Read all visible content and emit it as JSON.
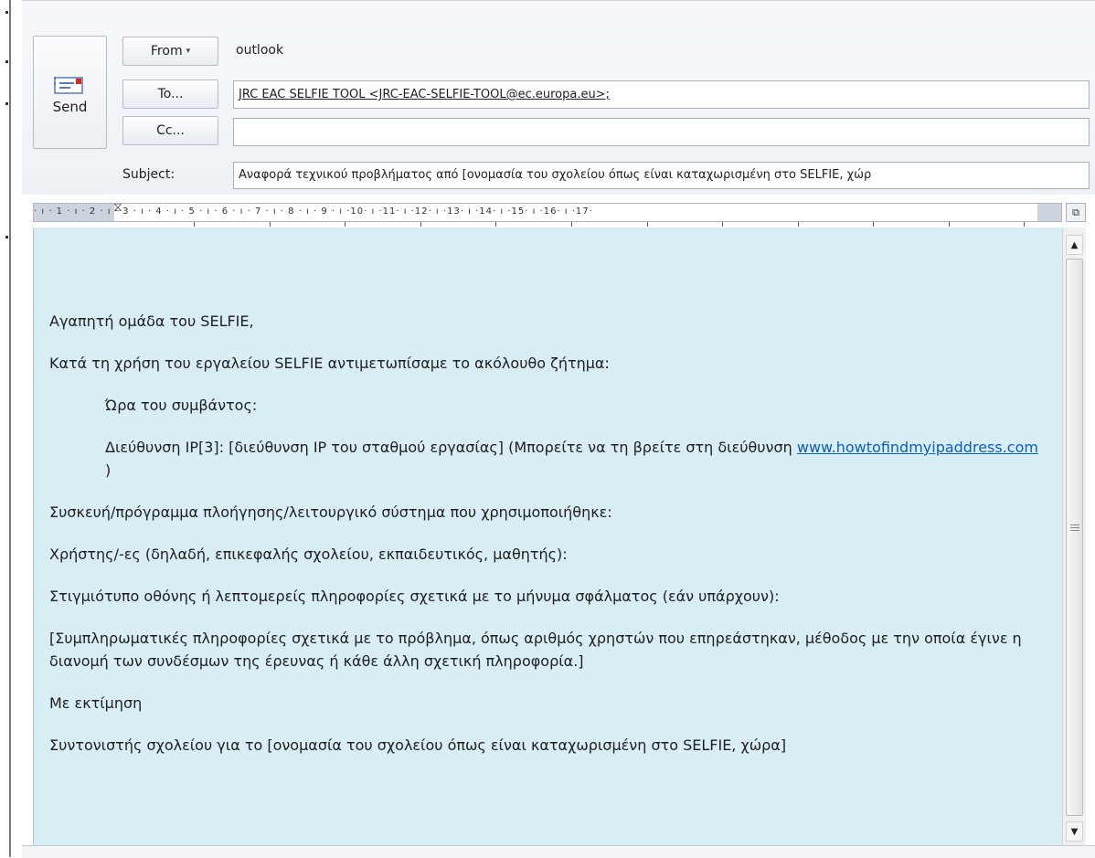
{
  "header": {
    "send_label": "Send",
    "from_label": "From",
    "from_arrow": "▾",
    "from_value": "outlook",
    "to_label": "To...",
    "to_value": "JRC EAC SELFIE TOOL <JRC-EAC-SELFIE-TOOL@ec.europa.eu>;",
    "cc_label": "Cc...",
    "cc_value": "",
    "subject_label": "Subject:",
    "subject_value": "Αναφορά τεχνικού προβλήματος από [ονομασία του σχολείου όπως είναι καταχωρισμένη στο SELFIE, χώρ"
  },
  "ruler": {
    "scale": "· ı · 1 · ı · 2 · ı · 3 · ı · 4 · ı · 5 · ı · 6 · ı · 7 · ı · 8 · ı · 9 · ı ·10· ı ·11· ı ·12· ı ·13· ı ·14· ı ·15· ı ·16· ı ·17·",
    "corner_icon": "ruler-toggle-icon"
  },
  "body": {
    "greeting": "Αγαπητή ομάδα του SELFIE,",
    "intro": "Κατά τη χρήση του εργαλείου SELFIE αντιμετωπίσαμε το ακόλουθο ζήτημα:",
    "time_line": "Ώρα του συμβάντος:",
    "ip_line": "Διεύθυνση IP[3]: [διεύθυνση IP του σταθμού εργασίας] (Μπορείτε να τη βρείτε στη διεύθυνση",
    "ip_link": "www.howtofindmyipaddress.com",
    "ip_close": " )",
    "device_line": "Συσκευή/πρόγραμμα πλοήγησης/λειτουργικό σύστημα που χρησιμοποιήθηκε:",
    "users_line": "Χρήστης/-ες (δηλαδή, επικεφαλής σχολείου, εκπαιδευτικός, μαθητής):",
    "screenshot_line": "Στιγμιότυπο οθόνης ή λεπτομερείς πληροφορίες σχετικά με το μήνυμα σφάλματος (εάν υπάρχουν):",
    "extra_line": "[Συμπληρωματικές πληροφορίες σχετικά με το πρόβλημα, όπως αριθμός χρηστών που επηρεάστηκαν, μέθοδος με την οποία έγινε η διανομή των συνδέσμων της έρευνας ή κάθε άλλη σχετική πληροφορία.]",
    "closing": "Με εκτίμηση",
    "signature": "Συντονιστής σχολείου για το [ονομασία του σχολείου όπως είναι καταχωρισμένη στο SELFIE, χώρα]"
  },
  "scrollbar": {
    "up_icon": "▲",
    "down_icon": "▼"
  }
}
